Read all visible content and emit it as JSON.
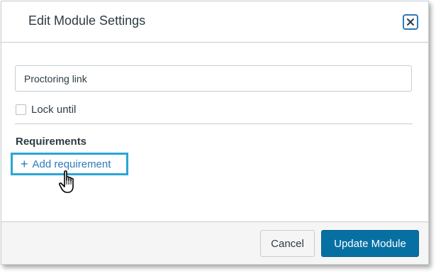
{
  "dialog": {
    "title": "Edit Module Settings",
    "close_icon": "close-icon"
  },
  "form": {
    "module_name_value": "Proctoring link",
    "lock_until_label": "Lock until",
    "lock_until_checked": false,
    "requirements_heading": "Requirements",
    "add_requirement_label": "Add requirement",
    "add_requirement_icon": "plus-icon"
  },
  "footer": {
    "cancel_label": "Cancel",
    "update_label": "Update Module"
  },
  "colors": {
    "primary": "#0770a3",
    "link": "#2b7abc",
    "focus_ring": "#2aa5d6",
    "text": "#2d3b45"
  }
}
